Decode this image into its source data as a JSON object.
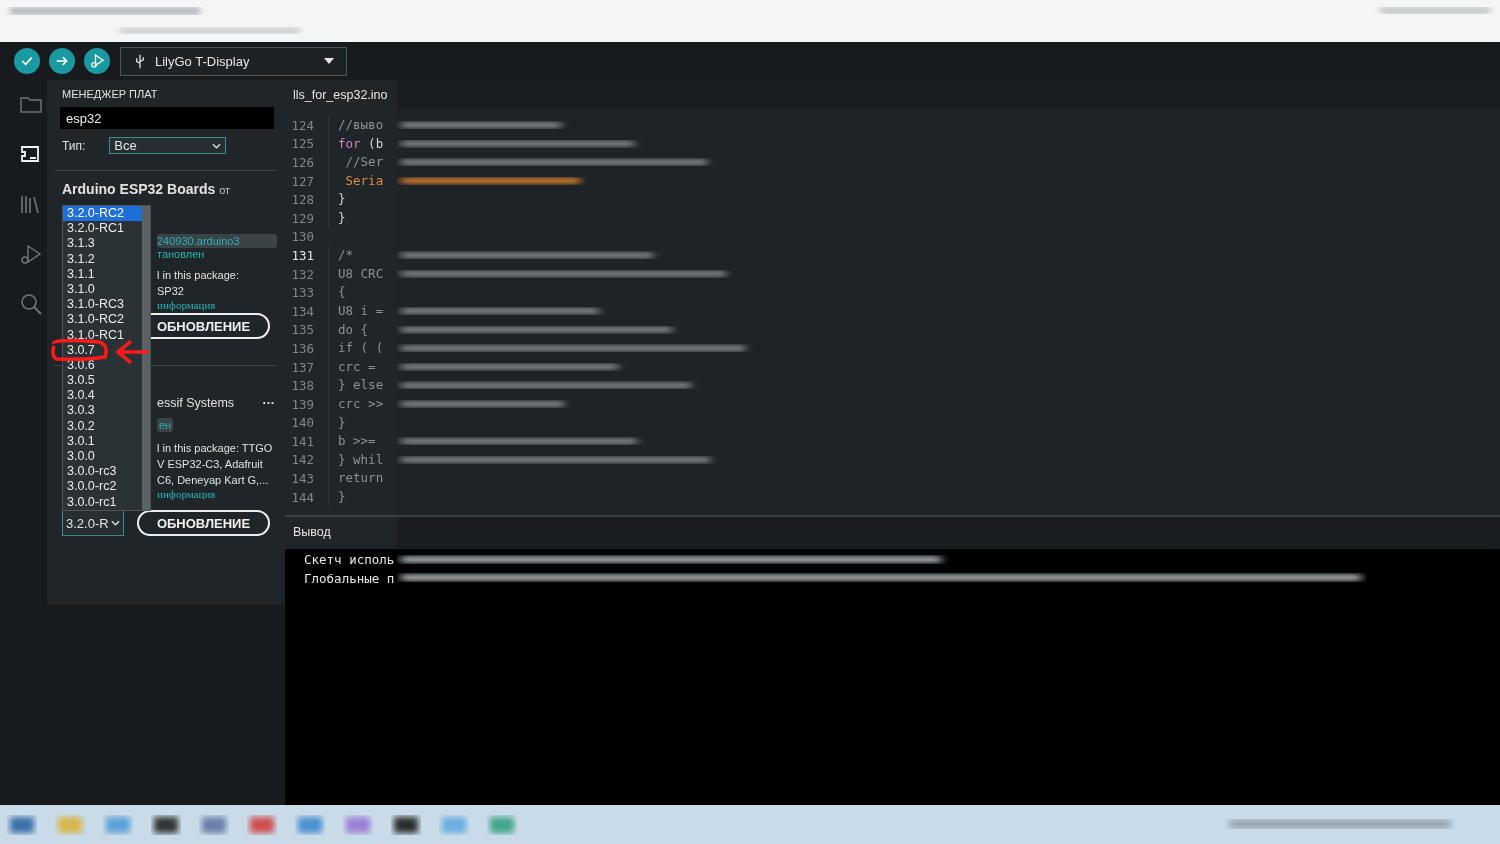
{
  "toolbar": {
    "buttons": [
      {
        "kind": "verify"
      },
      {
        "kind": "upload"
      },
      {
        "kind": "debug"
      }
    ],
    "board": "LilyGo T-Display"
  },
  "sidebar": {
    "items": [
      {
        "kind": "folder",
        "selected": false
      },
      {
        "kind": "board",
        "selected": true
      },
      {
        "kind": "library",
        "selected": false
      },
      {
        "kind": "debug",
        "selected": false
      },
      {
        "kind": "search",
        "selected": false
      }
    ]
  },
  "boards_manager": {
    "title": "МЕНЕДЖЕР ПЛАТ",
    "search": {
      "value": "esp32"
    },
    "type_filter": {
      "label": "Тип:",
      "value": "Все"
    },
    "packages": [
      {
        "title": "Arduino ESP32 Boards",
        "author": "от",
        "version_tag": "240930.arduino3",
        "status": "тановлен",
        "description": [
          "l in this package:",
          "SP32"
        ],
        "more_link": "информация",
        "button": "ОБНОВЛЕНИЕ"
      },
      {
        "author": "essif Systems",
        "menu": "···",
        "status": "ен",
        "description": [
          "l in this package: TTGO",
          "V ESP32-C3, Adafruit",
          "C6, Deneyap Kart G,..."
        ],
        "more_link": "информация",
        "button": "ОБНОВЛЕНИЕ",
        "version_select": {
          "value": "3.2.0-R",
          "expanded": true,
          "options": [
            {
              "label": "3.2.0-RC2",
              "selected": true
            },
            {
              "label": "3.2.0-RC1",
              "selected": false
            },
            {
              "label": "3.1.3",
              "selected": false
            },
            {
              "label": "3.1.2",
              "selected": false
            },
            {
              "label": "3.1.1",
              "selected": false
            },
            {
              "label": "3.1.0",
              "selected": false
            },
            {
              "label": "3.1.0-RC3",
              "selected": false
            },
            {
              "label": "3.1.0-RC2",
              "selected": false
            },
            {
              "label": "3.1.0-RC1",
              "selected": false
            },
            {
              "label": "3.0.7",
              "selected": false,
              "annotated": true
            },
            {
              "label": "3.0.6",
              "selected": false
            },
            {
              "label": "3.0.5",
              "selected": false
            },
            {
              "label": "3.0.4",
              "selected": false
            },
            {
              "label": "3.0.3",
              "selected": false
            },
            {
              "label": "3.0.2",
              "selected": false
            },
            {
              "label": "3.0.1",
              "selected": false
            },
            {
              "label": "3.0.0",
              "selected": false
            },
            {
              "label": "3.0.0-rc3",
              "selected": false
            },
            {
              "label": "3.0.0-rc2",
              "selected": false
            },
            {
              "label": "3.0.0-rc1",
              "selected": false
            }
          ]
        }
      }
    ]
  },
  "editor": {
    "tab": "lls_for_esp32.ino",
    "lines": [
      {
        "number": "124",
        "current": false,
        "tokens": [
          {
            "text": "//выво",
            "kind": "comment"
          }
        ]
      },
      {
        "number": "125",
        "current": false,
        "tokens": [
          {
            "text": "for",
            "kind": "keyword"
          },
          {
            "text": " (b",
            "kind": "plain"
          }
        ]
      },
      {
        "number": "126",
        "current": false,
        "tokens": [
          {
            "text": " //Ser",
            "kind": "comment"
          }
        ]
      },
      {
        "number": "127",
        "current": false,
        "tokens": [
          {
            "text": " Seria",
            "kind": "function"
          }
        ]
      },
      {
        "number": "128",
        "current": false,
        "tokens": [
          {
            "text": "}",
            "kind": "plain"
          }
        ]
      },
      {
        "number": "129",
        "current": false,
        "tokens": [
          {
            "text": "}",
            "kind": "plain"
          }
        ]
      },
      {
        "number": "130",
        "current": false
      },
      {
        "number": "131",
        "current": true,
        "tokens": [
          {
            "text": "/*",
            "kind": "comment"
          }
        ]
      },
      {
        "number": "132",
        "current": false,
        "tokens": [
          {
            "text": "U8 CRC",
            "kind": "comment"
          }
        ]
      },
      {
        "number": "133",
        "current": false,
        "tokens": [
          {
            "text": "{",
            "kind": "comment"
          }
        ]
      },
      {
        "number": "134",
        "current": false,
        "tokens": [
          {
            "text": "U8 i =",
            "kind": "comment"
          }
        ]
      },
      {
        "number": "135",
        "current": false,
        "tokens": [
          {
            "text": "do {",
            "kind": "comment"
          }
        ]
      },
      {
        "number": "136",
        "current": false,
        "tokens": [
          {
            "text": "if ( (",
            "kind": "comment"
          }
        ]
      },
      {
        "number": "137",
        "current": false,
        "tokens": [
          {
            "text": "crc =",
            "kind": "comment"
          }
        ]
      },
      {
        "number": "138",
        "current": false,
        "tokens": [
          {
            "text": "} else",
            "kind": "comment"
          }
        ]
      },
      {
        "number": "139",
        "current": false,
        "tokens": [
          {
            "text": "crc >>",
            "kind": "comment"
          }
        ]
      },
      {
        "number": "140",
        "current": false,
        "tokens": [
          {
            "text": "}",
            "kind": "comment"
          }
        ]
      },
      {
        "number": "141",
        "current": false,
        "tokens": [
          {
            "text": "b >>=",
            "kind": "comment"
          }
        ]
      },
      {
        "number": "142",
        "current": false,
        "tokens": [
          {
            "text": "} whil",
            "kind": "comment"
          }
        ]
      },
      {
        "number": "143",
        "current": false,
        "tokens": [
          {
            "text": "return",
            "kind": "comment"
          }
        ]
      },
      {
        "number": "144",
        "current": false,
        "tokens": [
          {
            "text": "}",
            "kind": "comment"
          }
        ]
      }
    ]
  },
  "output": {
    "title": "Вывод",
    "lines": [
      "Скетч исполь",
      "Глобальные п"
    ]
  }
}
